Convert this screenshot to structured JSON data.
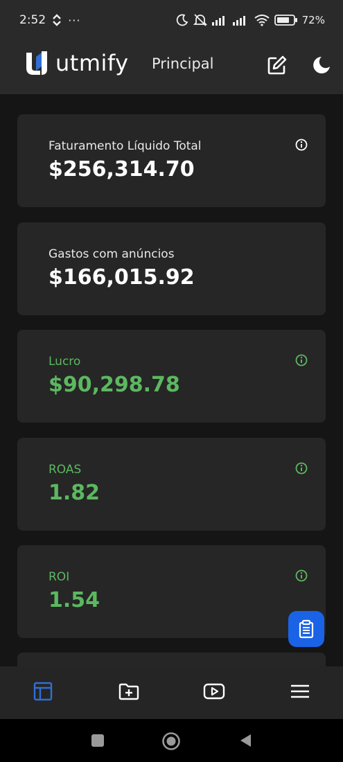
{
  "status": {
    "time": "2:52",
    "battery": "72"
  },
  "header": {
    "brand": "utmify",
    "page_title": "Principal",
    "icons": [
      "edit-icon",
      "moon-icon"
    ]
  },
  "cards": [
    {
      "label": "Faturamento Líquido Total",
      "value": "$256,314.70",
      "has_info": true,
      "color": "#ffffff"
    },
    {
      "label": "Gastos com anúncios",
      "value": "$166,015.92",
      "has_info": false,
      "color": "#ffffff"
    },
    {
      "label": "Lucro",
      "value": "$90,298.78",
      "has_info": true,
      "color": "#5cb860"
    },
    {
      "label": "ROAS",
      "value": "1.82",
      "has_info": true,
      "color": "#5cb860"
    },
    {
      "label": "ROI",
      "value": "1.54",
      "has_info": true,
      "color": "#5cb860"
    }
  ],
  "fab": {
    "icon": "clipboard-icon",
    "color": "#1a63e6"
  },
  "bottom_nav": [
    {
      "icon": "dashboard-icon",
      "active": true
    },
    {
      "icon": "folder-plus-icon",
      "active": false
    },
    {
      "icon": "video-play-icon",
      "active": false
    },
    {
      "icon": "menu-icon",
      "active": false
    }
  ],
  "colors": {
    "accent": "#2f6fd6",
    "profit": "#5cb860",
    "card_bg": "#262626",
    "page_bg": "#151515"
  }
}
